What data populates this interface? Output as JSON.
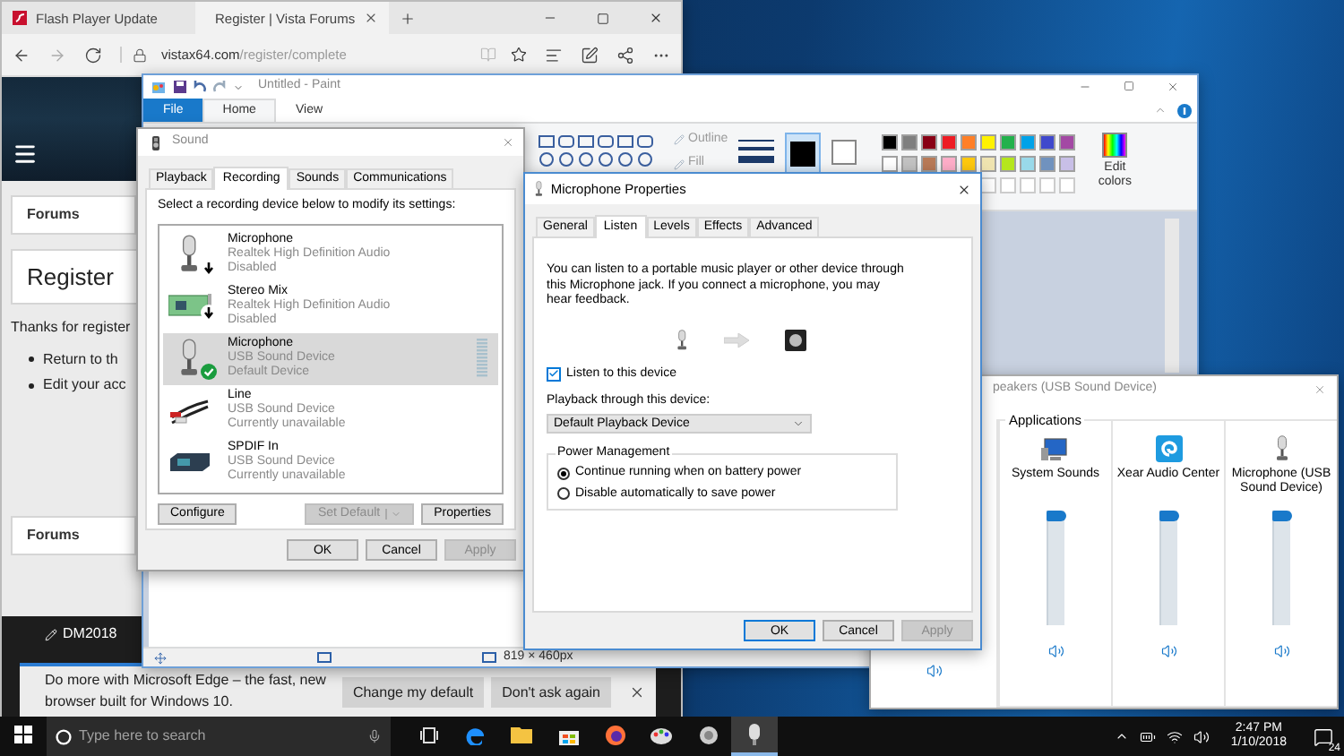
{
  "browser": {
    "tabs": [
      {
        "label": "Flash Player Update",
        "selected": false
      },
      {
        "label": "Register | Vista Forums",
        "selected": true
      }
    ],
    "address": {
      "domain": "vistax64.com",
      "path": "/register/complete"
    },
    "page": {
      "breadcrumb": "Forums",
      "heading": "Register",
      "intro": "Thanks for register",
      "bullets": [
        "Return to th",
        "Edit your acc"
      ],
      "footer_breadcrumb": "Forums",
      "username": "DM2018"
    },
    "notification": {
      "message": "Do more with Microsoft Edge – the fast, new browser built for Windows 10.",
      "buttons": [
        "Change my default",
        "Don't ask again"
      ]
    }
  },
  "paint": {
    "title": "Untitled - Paint",
    "tabs": [
      {
        "label": "File",
        "kind": "file",
        "selected": false
      },
      {
        "label": "Home",
        "kind": "tab",
        "selected": true
      },
      {
        "label": "View",
        "kind": "tab",
        "selected": false
      }
    ],
    "outline": "Outline",
    "fill": "Fill",
    "palette": [
      {
        "color": "#000000"
      },
      {
        "color": "#7f7f7f"
      },
      {
        "color": "#880015"
      },
      {
        "color": "#ed1c24"
      },
      {
        "color": "#ff7f27"
      },
      {
        "color": "#fff200"
      },
      {
        "color": "#22b14c"
      },
      {
        "color": "#00a2e8"
      },
      {
        "color": "#3f48cc"
      },
      {
        "color": "#a349a4"
      },
      {
        "color": "#ffffff"
      },
      {
        "color": "#c3c3c3"
      },
      {
        "color": "#b97a57"
      },
      {
        "color": "#ffaec9"
      },
      {
        "color": "#ffc90e"
      },
      {
        "color": "#efe4b0"
      },
      {
        "color": "#b5e61d"
      },
      {
        "color": "#99d9ea"
      },
      {
        "color": "#7092be"
      },
      {
        "color": "#c8bfe7"
      }
    ],
    "edit_colors": "Edit colors",
    "canvas_size": "819 × 460px"
  },
  "sound": {
    "title": "Sound",
    "tabs": [
      {
        "label": "Playback",
        "selected": false
      },
      {
        "label": "Recording",
        "selected": true
      },
      {
        "label": "Sounds",
        "selected": false
      },
      {
        "label": "Communications",
        "selected": false
      }
    ],
    "instruction": "Select a recording device below to modify its settings:",
    "devices": [
      {
        "name": "Microphone",
        "driver": "Realtek High Definition Audio",
        "status": "Disabled",
        "kind": "microphone",
        "disabled": true,
        "default": false,
        "selected": false
      },
      {
        "name": "Stereo Mix",
        "driver": "Realtek High Definition Audio",
        "status": "Disabled",
        "kind": "card",
        "disabled": true,
        "default": false,
        "selected": false
      },
      {
        "name": "Microphone",
        "driver": "USB Sound Device",
        "status": "Default Device",
        "kind": "microphone",
        "disabled": false,
        "default": true,
        "selected": true
      },
      {
        "name": "Line",
        "driver": "USB Sound Device",
        "status": "Currently unavailable",
        "kind": "line",
        "disabled": false,
        "default": false,
        "selected": false
      },
      {
        "name": "SPDIF In",
        "driver": "USB Sound Device",
        "status": "Currently unavailable",
        "kind": "spdif",
        "disabled": false,
        "default": false,
        "selected": false
      }
    ],
    "buttons": [
      {
        "label": "Configure",
        "kind": "plain",
        "disabled": false
      },
      {
        "label": "Set Default",
        "kind": "split",
        "disabled": true
      },
      {
        "label": "Properties",
        "kind": "plain",
        "disabled": false
      }
    ],
    "footer_buttons": [
      {
        "label": "OK",
        "default": false,
        "disabled": false
      },
      {
        "label": "Cancel",
        "default": false,
        "disabled": false
      },
      {
        "label": "Apply",
        "default": false,
        "disabled": true
      }
    ]
  },
  "properties": {
    "title": "Microphone Properties",
    "tabs": [
      {
        "label": "General",
        "selected": false
      },
      {
        "label": "Listen",
        "selected": true
      },
      {
        "label": "Levels",
        "selected": false
      },
      {
        "label": "Effects",
        "selected": false
      },
      {
        "label": "Advanced",
        "selected": false
      }
    ],
    "description": "You can listen to a portable music player or other device through this Microphone jack.  If you connect a microphone, you may hear feedback.",
    "listen": {
      "label": "Listen to this device",
      "checked": true
    },
    "playback_label": "Playback through this device:",
    "playback_device": "Default Playback Device",
    "power_group": "Power Management",
    "power_options": [
      {
        "label": "Continue running when on battery power",
        "selected": true
      },
      {
        "label": "Disable automatically to save power",
        "selected": false
      }
    ],
    "buttons": [
      {
        "label": "OK",
        "default": true,
        "disabled": false
      },
      {
        "label": "Cancel",
        "default": false,
        "disabled": false
      },
      {
        "label": "Apply",
        "default": false,
        "disabled": true
      }
    ]
  },
  "mixer": {
    "title": "peakers (USB Sound Device)",
    "group": "Applications",
    "device": {
      "muted": false
    },
    "apps": [
      {
        "name": "System Sounds",
        "kind": "system",
        "level": 1,
        "muted": false
      },
      {
        "name": "Xear Audio Center",
        "kind": "xear",
        "level": 1,
        "muted": false
      },
      {
        "name": "Microphone (USB Sound Device)",
        "kind": "microphone",
        "level": 1,
        "muted": false
      }
    ]
  },
  "taskbar": {
    "search_placeholder": "Type here to search",
    "apps": [
      {
        "kind": "edge",
        "selected": false
      },
      {
        "kind": "folder",
        "selected": false
      },
      {
        "kind": "store",
        "selected": false
      },
      {
        "kind": "firefox",
        "selected": false
      },
      {
        "kind": "paint",
        "selected": false
      },
      {
        "kind": "sound",
        "selected": false
      },
      {
        "kind": "microphone",
        "selected": true
      }
    ],
    "time": "2:47 PM",
    "date": "1/10/2018",
    "notification_count": "24"
  }
}
